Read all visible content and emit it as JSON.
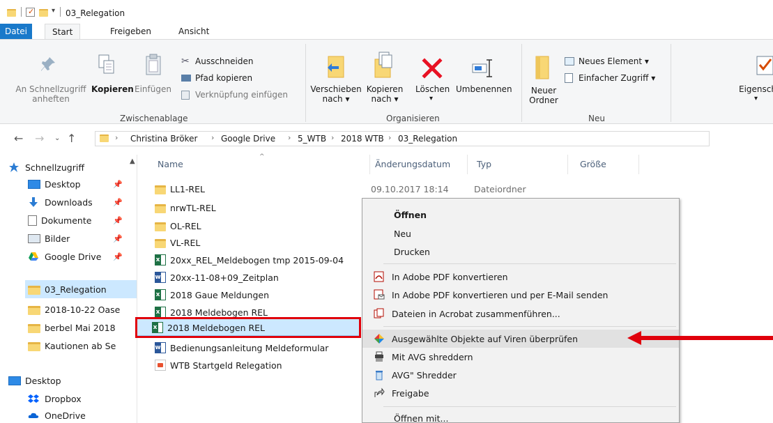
{
  "window": {
    "title": "03_Relegation"
  },
  "tabs": {
    "datei": "Datei",
    "start": "Start",
    "freigeben": "Freigeben",
    "ansicht": "Ansicht"
  },
  "ribbon": {
    "pin_line1": "An Schnellzugriff",
    "pin_line2": "anheften",
    "kopieren": "Kopieren",
    "einfuegen": "Einfügen",
    "ausschneiden": "Ausschneiden",
    "pfad_kopieren": "Pfad kopieren",
    "verknuepfung": "Verknüpfung einfügen",
    "group_clipboard": "Zwischenablage",
    "verschieben_line1": "Verschieben",
    "verschieben_line2": "nach ▾",
    "kopieren_nach_line1": "Kopieren",
    "kopieren_nach_line2": "nach ▾",
    "loeschen": "Löschen",
    "loeschen_arrow": "▾",
    "umbenennen": "Umbenennen",
    "group_organize": "Organisieren",
    "neuer_ordner_line1": "Neuer",
    "neuer_ordner_line2": "Ordner",
    "neues_element": "Neues Element ▾",
    "einfacher_zugriff": "Einfacher Zugriff ▾",
    "group_new": "Neu",
    "eigenschaften": "Eigensch",
    "eigenschaften_arrow": "▾"
  },
  "address": {
    "crumbs": [
      "Christina Bröker",
      "Google Drive",
      "5_WTB",
      "2018 WTB",
      "03_Relegation"
    ]
  },
  "nav": {
    "items": [
      {
        "label": "Schnellzugriff"
      },
      {
        "label": "Desktop"
      },
      {
        "label": "Downloads"
      },
      {
        "label": "Dokumente"
      },
      {
        "label": "Bilder"
      },
      {
        "label": "Google Drive"
      },
      {
        "label": "03_Relegation"
      },
      {
        "label": "2018-10-22 Oase"
      },
      {
        "label": "berbel Mai 2018"
      },
      {
        "label": "Kautionen ab Se"
      },
      {
        "label": "Desktop"
      },
      {
        "label": "Dropbox"
      },
      {
        "label": "OneDrive"
      }
    ]
  },
  "columns": {
    "name": "Name",
    "date": "Änderungsdatum",
    "type": "Typ",
    "size": "Größe"
  },
  "files": [
    {
      "name": "LL1-REL",
      "kind": "folder",
      "date": "09.10.2017 18:14",
      "type": "Dateiordner"
    },
    {
      "name": "nrwTL-REL",
      "kind": "folder"
    },
    {
      "name": "OL-REL",
      "kind": "folder"
    },
    {
      "name": "VL-REL",
      "kind": "folder"
    },
    {
      "name": "20xx_REL_Meldebogen tmp 2015-09-04",
      "kind": "excel"
    },
    {
      "name": "20xx-11-08+09_Zeitplan",
      "kind": "word"
    },
    {
      "name": "2018 Gaue Meldungen",
      "kind": "excel"
    },
    {
      "name": "2018 Meldebogen REL",
      "kind": "excel"
    },
    {
      "name": "2018 Meldebogen REL",
      "kind": "excel"
    },
    {
      "name": "Bedienungsanleitung Meldeformular",
      "kind": "word"
    },
    {
      "name": "WTB Startgeld Relegation",
      "kind": "pdf"
    }
  ],
  "context_menu": {
    "items": [
      {
        "label": "Öffnen"
      },
      {
        "label": "Neu"
      },
      {
        "label": "Drucken"
      },
      {
        "label": "In Adobe PDF konvertieren"
      },
      {
        "label": "In Adobe PDF konvertieren und per E-Mail senden"
      },
      {
        "label": "Dateien in Acrobat zusammenführen..."
      },
      {
        "label": "Ausgewählte Objekte auf Viren überprüfen"
      },
      {
        "label": "Mit AVG shreddern"
      },
      {
        "label": "AVG\" Shredder"
      },
      {
        "label": "Freigabe"
      },
      {
        "label": "Öffnen mit..."
      }
    ]
  },
  "colors": {
    "accent": "#1979ca",
    "highlight_red": "#e0000b",
    "selection": "#cce8ff"
  }
}
